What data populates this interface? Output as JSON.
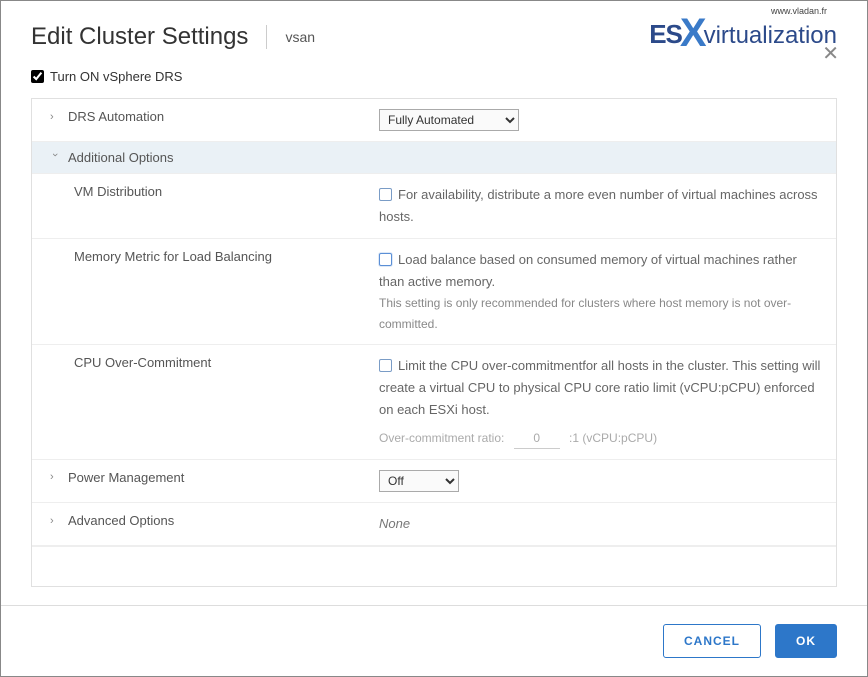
{
  "header": {
    "title": "Edit Cluster Settings",
    "cluster": "vsan",
    "logo_url": "www.vladan.fr",
    "logo_left": "ES",
    "logo_x": "X",
    "logo_right": "virtualization"
  },
  "drs_toggle": {
    "label": "Turn ON vSphere DRS",
    "checked": true
  },
  "rows": {
    "drs_automation": {
      "label": "DRS Automation",
      "value": "Fully Automated",
      "options": [
        "Fully Automated"
      ]
    },
    "additional_options": {
      "label": "Additional Options"
    },
    "vm_distribution": {
      "label": "VM Distribution",
      "desc": "For availability, distribute a more even number of virtual machines across hosts."
    },
    "memory_metric": {
      "label": "Memory Metric for Load Balancing",
      "desc": "Load balance based on consumed memory of virtual machines rather than active memory.",
      "hint": "This setting is only recommended for clusters where host memory is not over-committed."
    },
    "cpu_overcommit": {
      "label": "CPU Over-Commitment",
      "desc": "Limit the CPU over-commitmentfor all hosts in the cluster. This setting will create a virtual CPU to physical CPU core ratio limit (vCPU:pCPU) enforced on each ESXi host.",
      "ratio_label": "Over-commitment ratio:",
      "ratio_value": "0",
      "ratio_suffix": ":1 (vCPU:pCPU)"
    },
    "power_mgmt": {
      "label": "Power Management",
      "value": "Off",
      "options": [
        "Off"
      ]
    },
    "advanced": {
      "label": "Advanced Options",
      "value": "None"
    }
  },
  "footer": {
    "cancel": "CANCEL",
    "ok": "OK"
  }
}
